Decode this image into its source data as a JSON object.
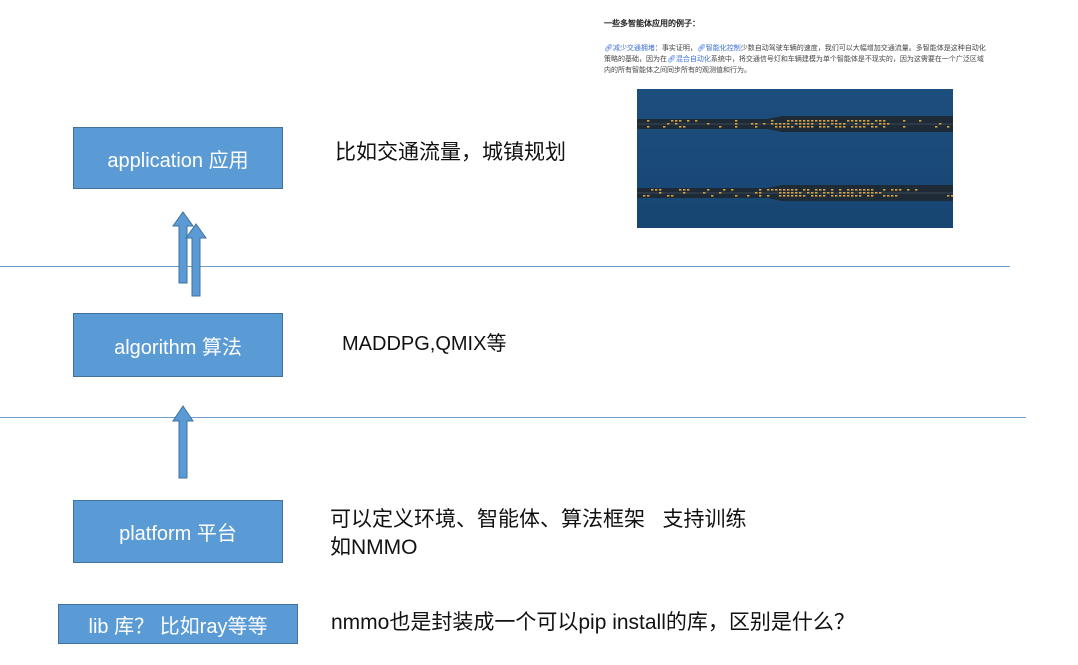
{
  "layers": [
    {
      "label": "application 应用",
      "description": "比如交通流量，城镇规划"
    },
    {
      "label": "algorithm 算法",
      "description": "MADDPG,QMIX等"
    },
    {
      "label": "platform 平台",
      "description_line1": "可以定义环境、智能体、算法框架   支持训练",
      "description_line2": "如NMMO"
    },
    {
      "label": "lib 库？ 比如ray等等",
      "description": "nmmo也是封装成一个可以pip install的库，区别是什么？"
    }
  ],
  "snippet": {
    "heading": "一些多智能体应用的例子：",
    "link1": "减少交通拥堵",
    "text1": "：事实证明，",
    "link2": "智能化控制",
    "text2": "少数自动驾驶车辆的速度，我们可以大幅增加交通流量。多智能体是这种自动化策略的基础，因为在",
    "link3": "混合自动化",
    "text3": "系统中，将交通信号灯和车辆建模为单个智能体是不现实的，因为这需要在一个广泛区域内的所有智能体之间同步所有的观测值和行为。"
  },
  "colors": {
    "box_fill": "#5b9bd5",
    "box_border": "#41719c",
    "divider": "#6f9bc7",
    "road_background": "#1a4a78",
    "vehicle": "#d9a441"
  }
}
